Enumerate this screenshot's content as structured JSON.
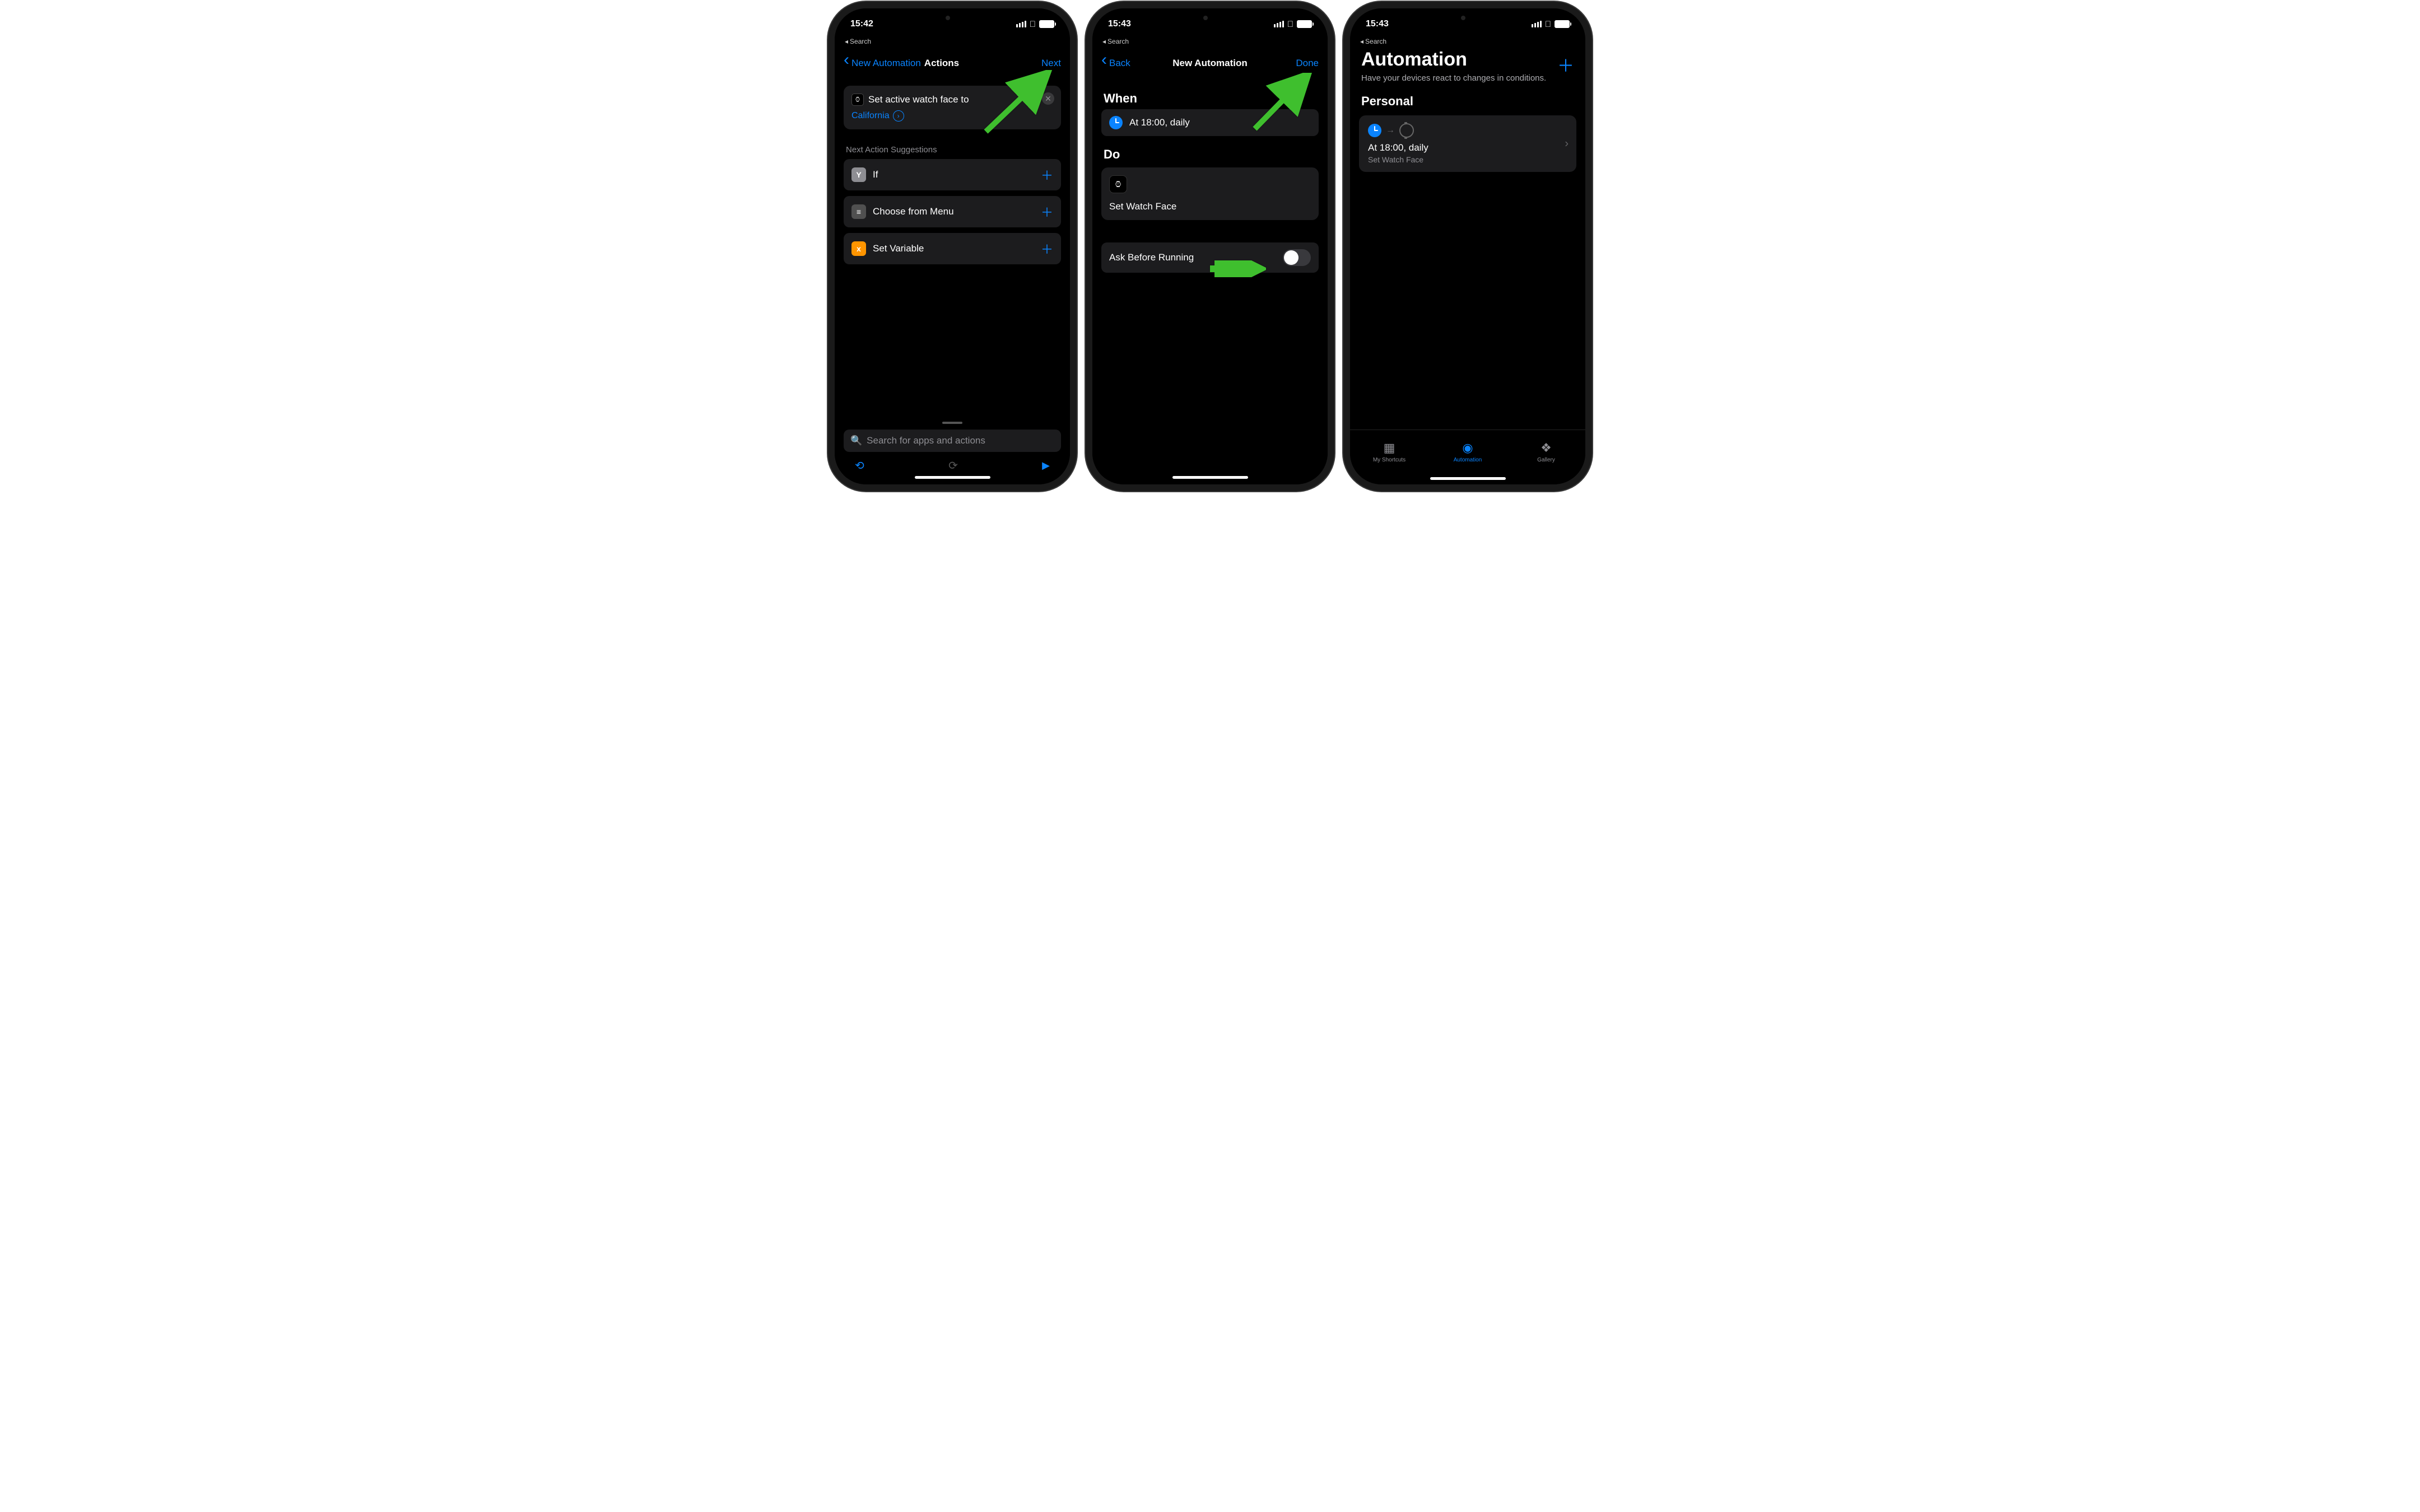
{
  "colors": {
    "accent": "#0a84ff",
    "arrow": "#3fbf2e"
  },
  "phone1": {
    "time": "15:42",
    "breadcrumb": "Search",
    "nav_back": "New Automation",
    "nav_title": "Actions",
    "nav_action": "Next",
    "card_line1": "Set active watch face to",
    "card_link": "California",
    "suggestions_label": "Next Action Suggestions",
    "rows": [
      {
        "icon": "Y",
        "label": "If"
      },
      {
        "icon": "≡",
        "label": "Choose from Menu"
      },
      {
        "icon": "x",
        "label": "Set Variable"
      }
    ],
    "search_placeholder": "Search for apps and actions"
  },
  "phone2": {
    "time": "15:43",
    "breadcrumb": "Search",
    "nav_back": "Back",
    "nav_title": "New Automation",
    "nav_action": "Done",
    "when_title": "When",
    "when_text": "At 18:00, daily",
    "do_title": "Do",
    "do_text": "Set Watch Face",
    "toggle_label": "Ask Before Running"
  },
  "phone3": {
    "time": "15:43",
    "breadcrumb": "Search",
    "title": "Automation",
    "subtitle": "Have your devices react to changes in conditions.",
    "personal": "Personal",
    "card_title": "At 18:00, daily",
    "card_sub": "Set Watch Face",
    "tabs": [
      {
        "label": "My Shortcuts"
      },
      {
        "label": "Automation"
      },
      {
        "label": "Gallery"
      }
    ]
  }
}
